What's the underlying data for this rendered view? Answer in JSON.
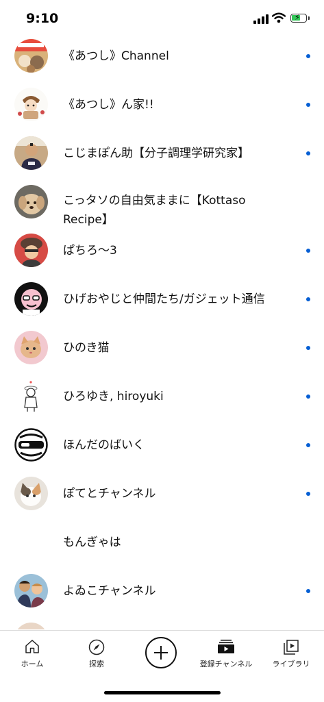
{
  "status_bar": {
    "time": "9:10"
  },
  "channels": [
    {
      "name": "《あつし》Channel",
      "new_content": true
    },
    {
      "name": "《あつし》ん家!!",
      "new_content": true
    },
    {
      "name": "こじまぽん助【分子調理学研究家】",
      "new_content": true
    },
    {
      "name": "こっタソの自由気ままに【Kottaso Recipe】",
      "new_content": false
    },
    {
      "name": "ぱちろ〜3",
      "new_content": true
    },
    {
      "name": "ひげおやじと仲間たち/ガジェット通信",
      "new_content": true
    },
    {
      "name": "ひのき猫",
      "new_content": true
    },
    {
      "name": "ひろゆき, hiroyuki",
      "new_content": true
    },
    {
      "name": "ほんだのばいく",
      "new_content": true
    },
    {
      "name": "ぽてとチャンネル",
      "new_content": true
    },
    {
      "name": "もんぎゃは",
      "new_content": false
    },
    {
      "name": "よゐこチャンネル",
      "new_content": true
    }
  ],
  "bottom_nav": {
    "home_label": "ホーム",
    "explore_label": "探索",
    "subscriptions_label": "登録チャンネル",
    "library_label": "ライブラリ"
  },
  "colors": {
    "unread_dot": "#065fd4",
    "battery": "#34c759"
  }
}
